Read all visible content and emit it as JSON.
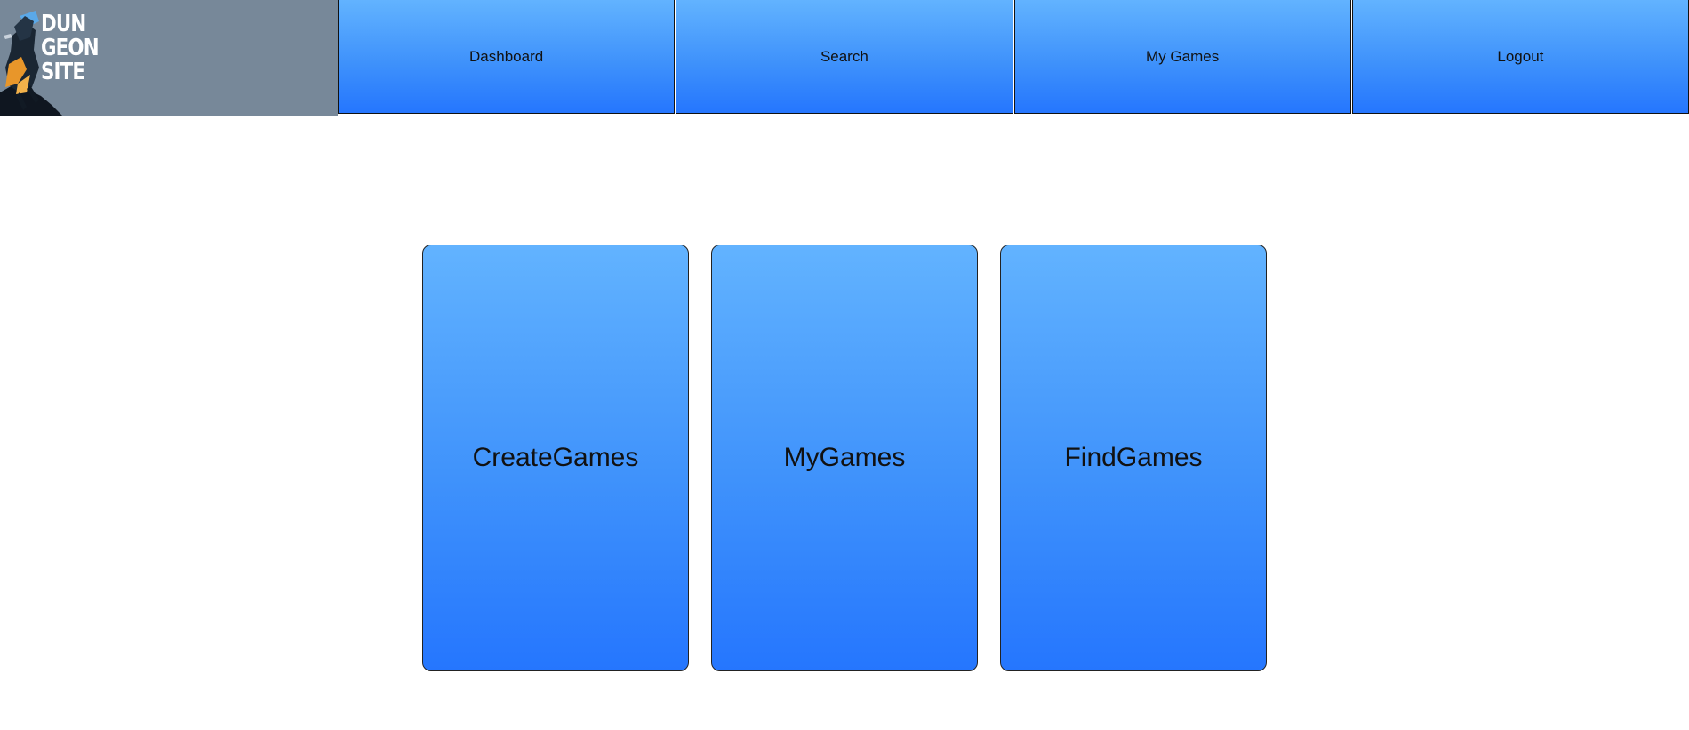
{
  "logo": {
    "lines": [
      "DUN",
      "GEON",
      "SITE"
    ],
    "icon": "hooded-rogue-icon"
  },
  "nav": {
    "items": [
      {
        "label": "Dashboard"
      },
      {
        "label": "Search"
      },
      {
        "label": "My Games"
      },
      {
        "label": "Logout"
      }
    ]
  },
  "cards": [
    {
      "label": "CreateGames"
    },
    {
      "label": "MyGames"
    },
    {
      "label": "FindGames"
    }
  ],
  "colors": {
    "header_bg": "#778899",
    "gradient_top": "#62b3ff",
    "gradient_bottom": "#2576fe",
    "border": "#111111"
  }
}
